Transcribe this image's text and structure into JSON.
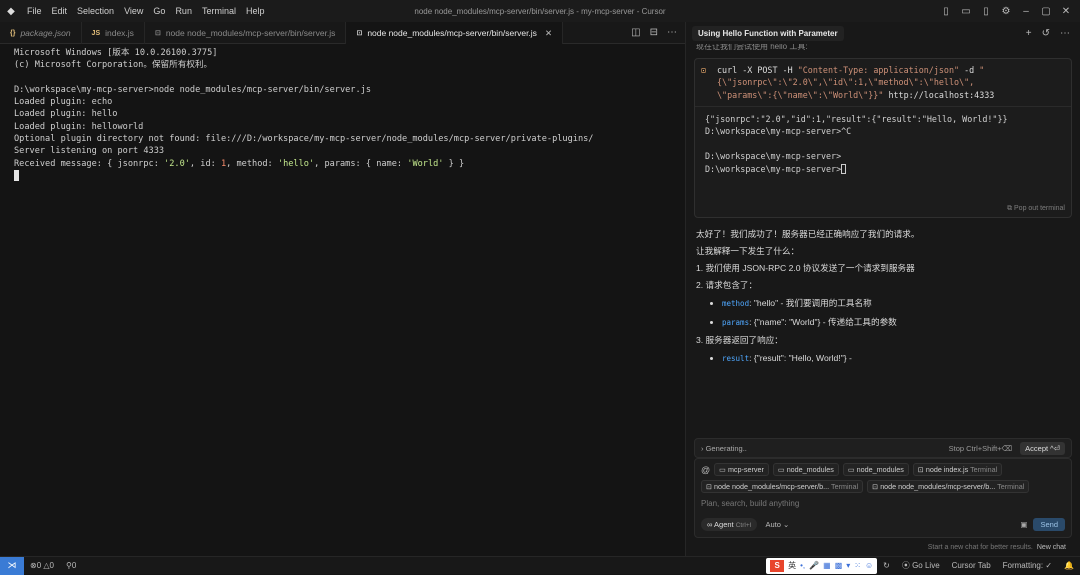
{
  "app": {
    "menu": [
      "File",
      "Edit",
      "Selection",
      "View",
      "Go",
      "Run",
      "Terminal",
      "Help"
    ],
    "window_title": "node node_modules/mcp-server/bin/server.js - my-mcp-server - Cursor"
  },
  "tabs": [
    {
      "icon": "{}",
      "label": "package.json",
      "active": false
    },
    {
      "icon": "JS",
      "label": "index.js",
      "active": false
    },
    {
      "icon": "⊡",
      "label": "node node_modules/mcp-server/bin/server.js",
      "active": false
    },
    {
      "icon": "⊡",
      "label": "node node_modules/mcp-server/bin/server.js",
      "active": true
    }
  ],
  "terminal": {
    "lines": [
      "Microsoft Windows [版本 10.0.26100.3775]",
      "(c) Microsoft Corporation。保留所有权利。",
      "",
      "D:\\workspace\\my-mcp-server>node node_modules/mcp-server/bin/server.js",
      "Loaded plugin: echo",
      "Loaded plugin: hello",
      "Loaded plugin: helloworld",
      "Optional plugin directory not found: file:///D:/workspace/my-mcp-server/node_modules/mcp-server/private-plugins/",
      "Server listening on port 4333"
    ],
    "received_prefix": "Received message: { jsonrpc: ",
    "received_jsonrpc": "'2.0'",
    "received_mid1": ", id: ",
    "received_id": "1",
    "received_mid2": ", method: ",
    "received_method": "'hello'",
    "received_mid3": ", params: { name: ",
    "received_name": "'World'",
    "received_end": " } }"
  },
  "chat": {
    "title": "Using Hello Function with Parameter",
    "cut_line": "现在让我们尝试使用 hello 工具:",
    "command": {
      "l1_a": "curl -X POST -H ",
      "l1_b": "\"Content-Type: application/json\"",
      "l1_c": " -d ",
      "l1_d": "\"",
      "l2": "{\\\"jsonrpc\\\":\\\"2.0\\\",\\\"id\\\":1,\\\"method\\\":\\\"hello\\\",",
      "l3_a": "\\\"params\\\":{\\\"name\\\":\\\"World\\\"}}\"",
      "l3_b": " http://localhost:4333"
    },
    "output": [
      "{\"jsonrpc\":\"2.0\",\"id\":1,\"result\":{\"result\":\"Hello, World!\"}}",
      "D:\\workspace\\my-mcp-server>^C",
      "",
      "D:\\workspace\\my-mcp-server>",
      "D:\\workspace\\my-mcp-server>"
    ],
    "popout": "Pop out terminal",
    "msg_line1": "太好了！我们成功了！服务器已经正确响应了我们的请求。",
    "msg_line2": "让我解释一下发生了什么：",
    "step1": "1. 我们使用 JSON-RPC 2.0 协议发送了一个请求到服务器",
    "step2": "2. 请求包含了：",
    "b1_key": "method",
    "b1_text": ": \"hello\" - 我们要调用的工具名称",
    "b2_key": "params",
    "b2_text": ": {\"name\": \"World\"} - 传递给工具的参数",
    "step3": "3. 服务器返回了响应：",
    "b3_key": "result",
    "b3_text": ": {\"result\": \"Hello, World!\"} -",
    "generating": "Generating..",
    "stop": "Stop Ctrl+Shift+⌫",
    "accept": "Accept ^⏎",
    "chips": [
      {
        "label": "mcp-server",
        "kind": ""
      },
      {
        "label": "node_modules",
        "kind": ""
      },
      {
        "label": "node_modules",
        "kind": ""
      },
      {
        "label": "node index.js",
        "kind": "Terminal"
      },
      {
        "label": "node node_modules/mcp-server/b...",
        "kind": "Terminal"
      },
      {
        "label": "node node_modules/mcp-server/b...",
        "kind": "Terminal"
      }
    ],
    "placeholder": "Plan, search, build anything",
    "agent": "Agent",
    "agent_kbd": "Ctrl+I",
    "auto": "Auto",
    "send": "Send",
    "hint": "Start a new chat for better results.",
    "hint_link": "New chat"
  },
  "status": {
    "errors": "0",
    "warnings": "0",
    "ports": "0",
    "golive": "Go Live",
    "cursor_tab": "Cursor Tab",
    "formatting": "Formatting: ✓",
    "ime": "英"
  }
}
